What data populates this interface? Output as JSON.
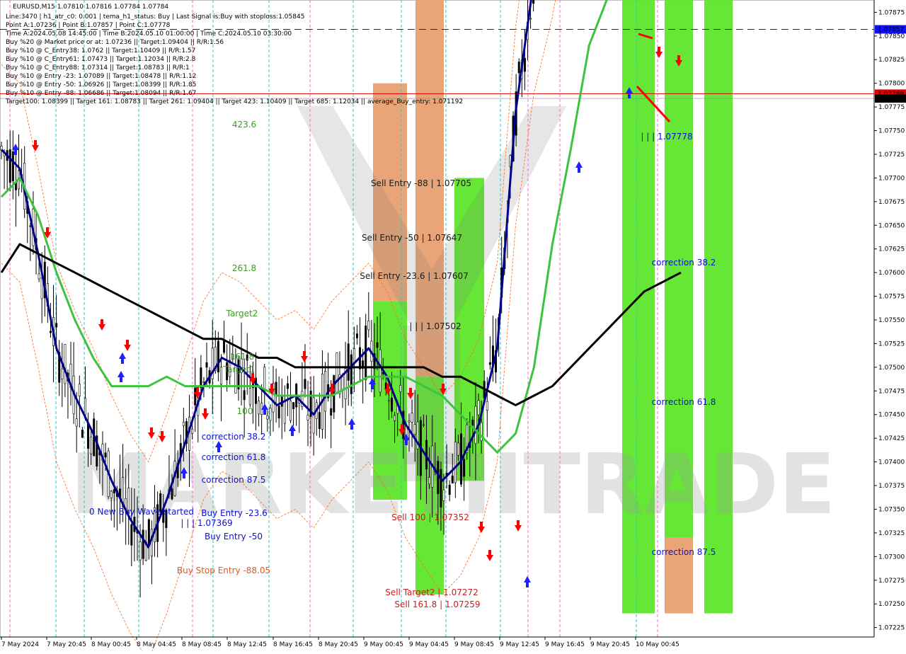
{
  "chart_data": {
    "type": "candlestick",
    "symbol": "EURUSD,M15",
    "ohlc_header": "1.07810 1.07816 1.07784 1.07784",
    "info_lines": [
      "Line:3470 | h1_atr_c0: 0.001 | tema_h1_status: Buy | Last Signal is:Buy with stoploss:1.05845",
      "Point A:1.07236 | Point B:1.07857 | Point C:1.07778",
      "Time A:2024.05.08 14:45:00 | Time B:2024.05.10 01:00:00 | Time C:2024.05.10 03:30:00",
      "Buy %20 @ Market price or at: 1.07236 || Target:1.09404 || R/R:1.56",
      "Buy %10 @ C_Entry38: 1.0762 || Target:1.10409 || R/R:1.57",
      "Buy %10 @ C_Entry61: 1.07473 || Target:1.12034 || R/R:2.8",
      "Buy %10 @ C_Entry88: 1.07314 || Target:1.08783 || R/R:1",
      "Buy %10 @ Entry -23: 1.07089 || Target:1.08478 || R/R:1.12",
      "Buy %10 @ Entry -50: 1.06926 || Target:1.08399 || R/R:1.85",
      "Buy %10 @ Entry -88: 1.06686 || Target:1.08094 || R/R:1.67",
      "Target100: 1.08399 || Target 161: 1.08783 || Target 261: 1.09404 || Target 423: 1.10409 || Target 685: 1.12034 || average_Buy_entry: 1.071192"
    ],
    "y_ticks": [
      1.07875,
      1.0785,
      1.07825,
      1.078,
      1.07775,
      1.0775,
      1.07725,
      1.077,
      1.07675,
      1.0765,
      1.07625,
      1.076,
      1.07575,
      1.0755,
      1.07525,
      1.075,
      1.07475,
      1.0745,
      1.07425,
      1.074,
      1.07375,
      1.0735,
      1.07325,
      1.073,
      1.07275,
      1.0725,
      1.07225
    ],
    "y_tick_labels": [
      "1.07875",
      "1.07850",
      "1.07825",
      "1.07800",
      "1.07775",
      "1.07750",
      "1.07725",
      "1.07700",
      "1.07675",
      "1.07650",
      "1.07625",
      "1.07600",
      "1.07575",
      "1.07550",
      "1.07525",
      "1.07500",
      "1.07475",
      "1.07450",
      "1.07425",
      "1.07400",
      "1.07375",
      "1.07350",
      "1.07325",
      "1.07300",
      "1.07275",
      "1.07250",
      "1.07225"
    ],
    "ylim": [
      1.07215,
      1.07888
    ],
    "x_tick_labels": [
      "7 May 2024",
      "7 May 20:45",
      "8 May 00:45",
      "8 May 04:45",
      "8 May 08:45",
      "8 May 12:45",
      "8 May 16:45",
      "8 May 20:45",
      "9 May 00:45",
      "9 May 04:45",
      "9 May 08:45",
      "9 May 12:45",
      "9 May 16:45",
      "9 May 20:45",
      "10 May 00:45"
    ],
    "price_markers": [
      {
        "label": "1.07857",
        "value": 1.07857,
        "color": "#1010ff"
      },
      {
        "label": "1.07789",
        "value": 1.07789,
        "color": "#dd0000"
      },
      {
        "label": "1.07784",
        "value": 1.07784,
        "color": "#000000"
      }
    ],
    "zones": [
      {
        "color": "#5ee62a",
        "from": 1.0736,
        "to": 1.0757
      },
      {
        "color": "#e8a070",
        "from": 1.0757,
        "to": 1.078
      },
      {
        "color": "#5ee62a",
        "from": 1.0726,
        "to": 1.0749
      },
      {
        "color": "#e8a070",
        "from": 1.0749,
        "to": 1.0789
      },
      {
        "color": "#5ee62a",
        "from": 1.0738,
        "to": 1.077
      },
      {
        "color": "#5ee62a",
        "from": 1.0724,
        "to": 1.0789
      },
      {
        "color": "#5ee62a",
        "from": 1.0732,
        "to": 1.0789
      },
      {
        "color": "#e8a070",
        "from": 1.0724,
        "to": 1.0732
      },
      {
        "color": "#5ee62a",
        "from": 1.0724,
        "to": 1.0789
      }
    ],
    "annotations": [
      {
        "text": "423.6",
        "color": "#3c9a28"
      },
      {
        "text": "261.8",
        "color": "#3c9a28"
      },
      {
        "text": "Target2",
        "color": "#3c9a28"
      },
      {
        "text": "161.8",
        "color": "#3c9a28"
      },
      {
        "text": "Target1",
        "color": "#3c9a28"
      },
      {
        "text": "100",
        "color": "#3c9a28"
      },
      {
        "text": "Sell Entry -88 | 1.07705",
        "color": "#1a1a1a"
      },
      {
        "text": "Sell Entry -50 | 1.07647",
        "color": "#1a1a1a"
      },
      {
        "text": "Sell Entry -23.6 | 1.07607",
        "color": "#1a1a1a"
      },
      {
        "text": "| | | 1.07502",
        "color": "#1a1a1a"
      },
      {
        "text": "Sell 100 | 1.07352",
        "color": "#c81e1e"
      },
      {
        "text": "Sell Target2 | 1.07272",
        "color": "#c81e1e"
      },
      {
        "text": "Sell 161.8 | 1.07259",
        "color": "#c81e1e"
      },
      {
        "text": "correction 38.2",
        "color": "#1010d0"
      },
      {
        "text": "correction 61.8",
        "color": "#1010d0"
      },
      {
        "text": "correction 87.5",
        "color": "#1010d0"
      },
      {
        "text": "0 New Buy Wave started",
        "color": "#1010d0"
      },
      {
        "text": "Buy Entry -23.6",
        "color": "#1010d0"
      },
      {
        "text": "| | | 1.07369",
        "color": "#1010d0"
      },
      {
        "text": "Buy Entry -50",
        "color": "#1010d0"
      },
      {
        "text": "Buy Stop Entry -88.05",
        "color": "#e05a1e"
      },
      {
        "text": "correction 38.2",
        "color": "#1010d0"
      },
      {
        "text": "correction 61.8",
        "color": "#1010d0"
      },
      {
        "text": "correction 87.5",
        "color": "#1010d0"
      },
      {
        "text": "| | | 1.07778",
        "color": "#1010d0"
      }
    ],
    "series": [
      {
        "name": "tema",
        "color": "#00008b",
        "values": [
          1.0773,
          1.0771,
          1.0762,
          1.0752,
          1.0747,
          1.0743,
          1.0738,
          1.0734,
          1.0731,
          1.0736,
          1.0742,
          1.0748,
          1.0751,
          1.075,
          1.0748,
          1.0746,
          1.0747,
          1.0745,
          1.0748,
          1.075,
          1.0752,
          1.0749,
          1.0744,
          1.0741,
          1.0738,
          1.074,
          1.0744,
          1.0752,
          1.0777,
          1.0791,
          1.0799,
          1.081,
          1.082,
          1.0828,
          1.0828,
          1.0826,
          1.0822,
          1.0825
        ]
      },
      {
        "name": "ma_green",
        "color": "#3cc43c",
        "values": [
          1.0768,
          1.077,
          1.0766,
          1.076,
          1.0755,
          1.0751,
          1.0748,
          1.0748,
          1.0748,
          1.0749,
          1.0748,
          1.0748,
          1.0748,
          1.0748,
          1.0748,
          1.0747,
          1.0747,
          1.0747,
          1.0747,
          1.0748,
          1.0749,
          1.0749,
          1.0749,
          1.0748,
          1.0747,
          1.0745,
          1.0743,
          1.0741,
          1.0743,
          1.075,
          1.0763,
          1.0773,
          1.0784,
          1.0789,
          1.0796,
          1.0802,
          1.0808,
          1.081
        ]
      },
      {
        "name": "ma_black",
        "color": "#000000",
        "values": [
          1.076,
          1.0763,
          1.0762,
          1.0761,
          1.076,
          1.0759,
          1.0758,
          1.0757,
          1.0756,
          1.0755,
          1.0754,
          1.0753,
          1.0753,
          1.0752,
          1.0751,
          1.0751,
          1.075,
          1.075,
          1.075,
          1.075,
          1.075,
          1.075,
          1.075,
          1.075,
          1.0749,
          1.0749,
          1.0748,
          1.0747,
          1.0746,
          1.0747,
          1.0748,
          1.075,
          1.0752,
          1.0754,
          1.0756,
          1.0758,
          1.0759,
          1.076
        ]
      }
    ],
    "watermark": "MARKETIITRADE",
    "grid": false
  }
}
